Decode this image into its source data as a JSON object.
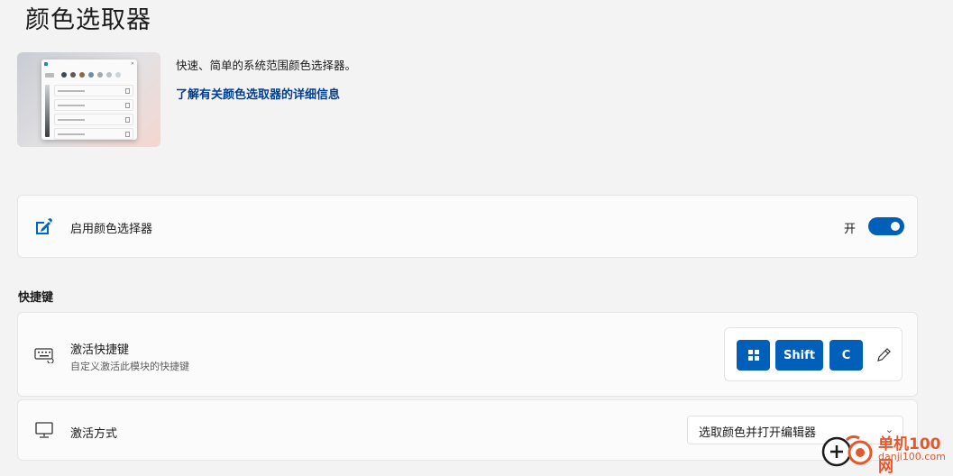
{
  "page": {
    "title": "颜色选取器"
  },
  "intro": {
    "description": "快速、简单的系统范围颜色选择器。",
    "learn_more": "了解有关颜色选取器的详细信息"
  },
  "enable": {
    "label": "启用颜色选择器",
    "state_text": "开",
    "checked": true
  },
  "shortcuts": {
    "heading": "快捷键",
    "label": "激活快捷键",
    "sublabel": "自定义激活此模块的快捷键",
    "keys": [
      "⊞",
      "Shift",
      "C"
    ]
  },
  "activation": {
    "label": "激活方式",
    "selected": "选取颜色并打开编辑器"
  },
  "watermark": {
    "name": "单机100网",
    "domain": "danji100.com"
  },
  "colors": {
    "accent": "#005fb8",
    "link": "#003e92",
    "watermark": "#e8562a"
  },
  "icons": [
    "color-picker-icon",
    "keyboard-icon",
    "windows-key-icon",
    "pencil-icon",
    "monitor-icon",
    "chevron-down-icon"
  ]
}
